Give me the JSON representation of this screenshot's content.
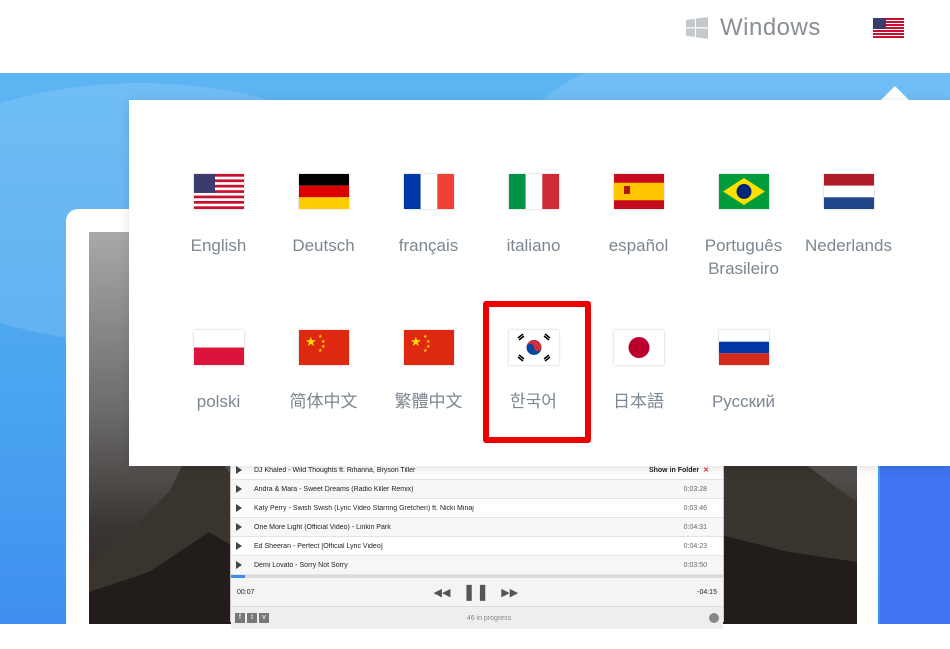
{
  "header": {
    "os_label": "Windows",
    "os_icon": "windows-logo-icon",
    "language_button_flag": "us-flag-icon"
  },
  "language_menu": {
    "languages": [
      {
        "label": "English",
        "flag": "us-flag-icon"
      },
      {
        "label": "Deutsch",
        "flag": "germany-flag-icon"
      },
      {
        "label": "français",
        "flag": "france-flag-icon"
      },
      {
        "label": "italiano",
        "flag": "italy-flag-icon"
      },
      {
        "label": "español",
        "flag": "spain-flag-icon"
      },
      {
        "label": "Português Brasileiro",
        "flag": "brazil-flag-icon"
      },
      {
        "label": "Nederlands",
        "flag": "netherlands-flag-icon"
      },
      {
        "label": "polski",
        "flag": "poland-flag-icon"
      },
      {
        "label": "简体中文",
        "flag": "china-flag-icon"
      },
      {
        "label": "繁體中文",
        "flag": "china-flag-icon"
      },
      {
        "label": "한국어",
        "flag": "korea-flag-icon"
      },
      {
        "label": "日本語",
        "flag": "japan-flag-icon"
      },
      {
        "label": "Русский",
        "flag": "russia-flag-icon"
      }
    ],
    "highlighted": "한국어"
  },
  "player": {
    "tracks": [
      {
        "title": "DJ Khaled - Wild Thoughts ft. Rihanna, Bryson Tiller",
        "duration": "",
        "show_in_folder": "Show in Folder",
        "remove": "✕"
      },
      {
        "title": "Andra & Mara - Sweet Dreams (Radio Killer Remix)",
        "duration": "0:03:28"
      },
      {
        "title": "Katy Perry - Swish Swish (Lyric Video Starring Gretchen) ft. Nicki Minaj",
        "duration": "0:03:46"
      },
      {
        "title": "One More Light (Official Video) - Linkin Park",
        "duration": "0:04:31"
      },
      {
        "title": "Ed Sheeran - Perfect [Official Lyric Video]",
        "duration": "0:04:23"
      },
      {
        "title": "Demi Lovato - Sorry Not Sorry",
        "duration": "0:03:50"
      }
    ],
    "elapsed": "00:07",
    "remaining": "-04:15",
    "status": "46 in progress",
    "controls": {
      "prev": "◀◀",
      "pause": "❚❚",
      "next": "▶▶"
    },
    "social": [
      "f",
      "t",
      "v"
    ]
  },
  "colors": {
    "hero_blue": "#4aa4f0",
    "label_gray": "#7b8793",
    "highlight_red": "#ee0000",
    "dark_blue": "#3f74f2"
  }
}
